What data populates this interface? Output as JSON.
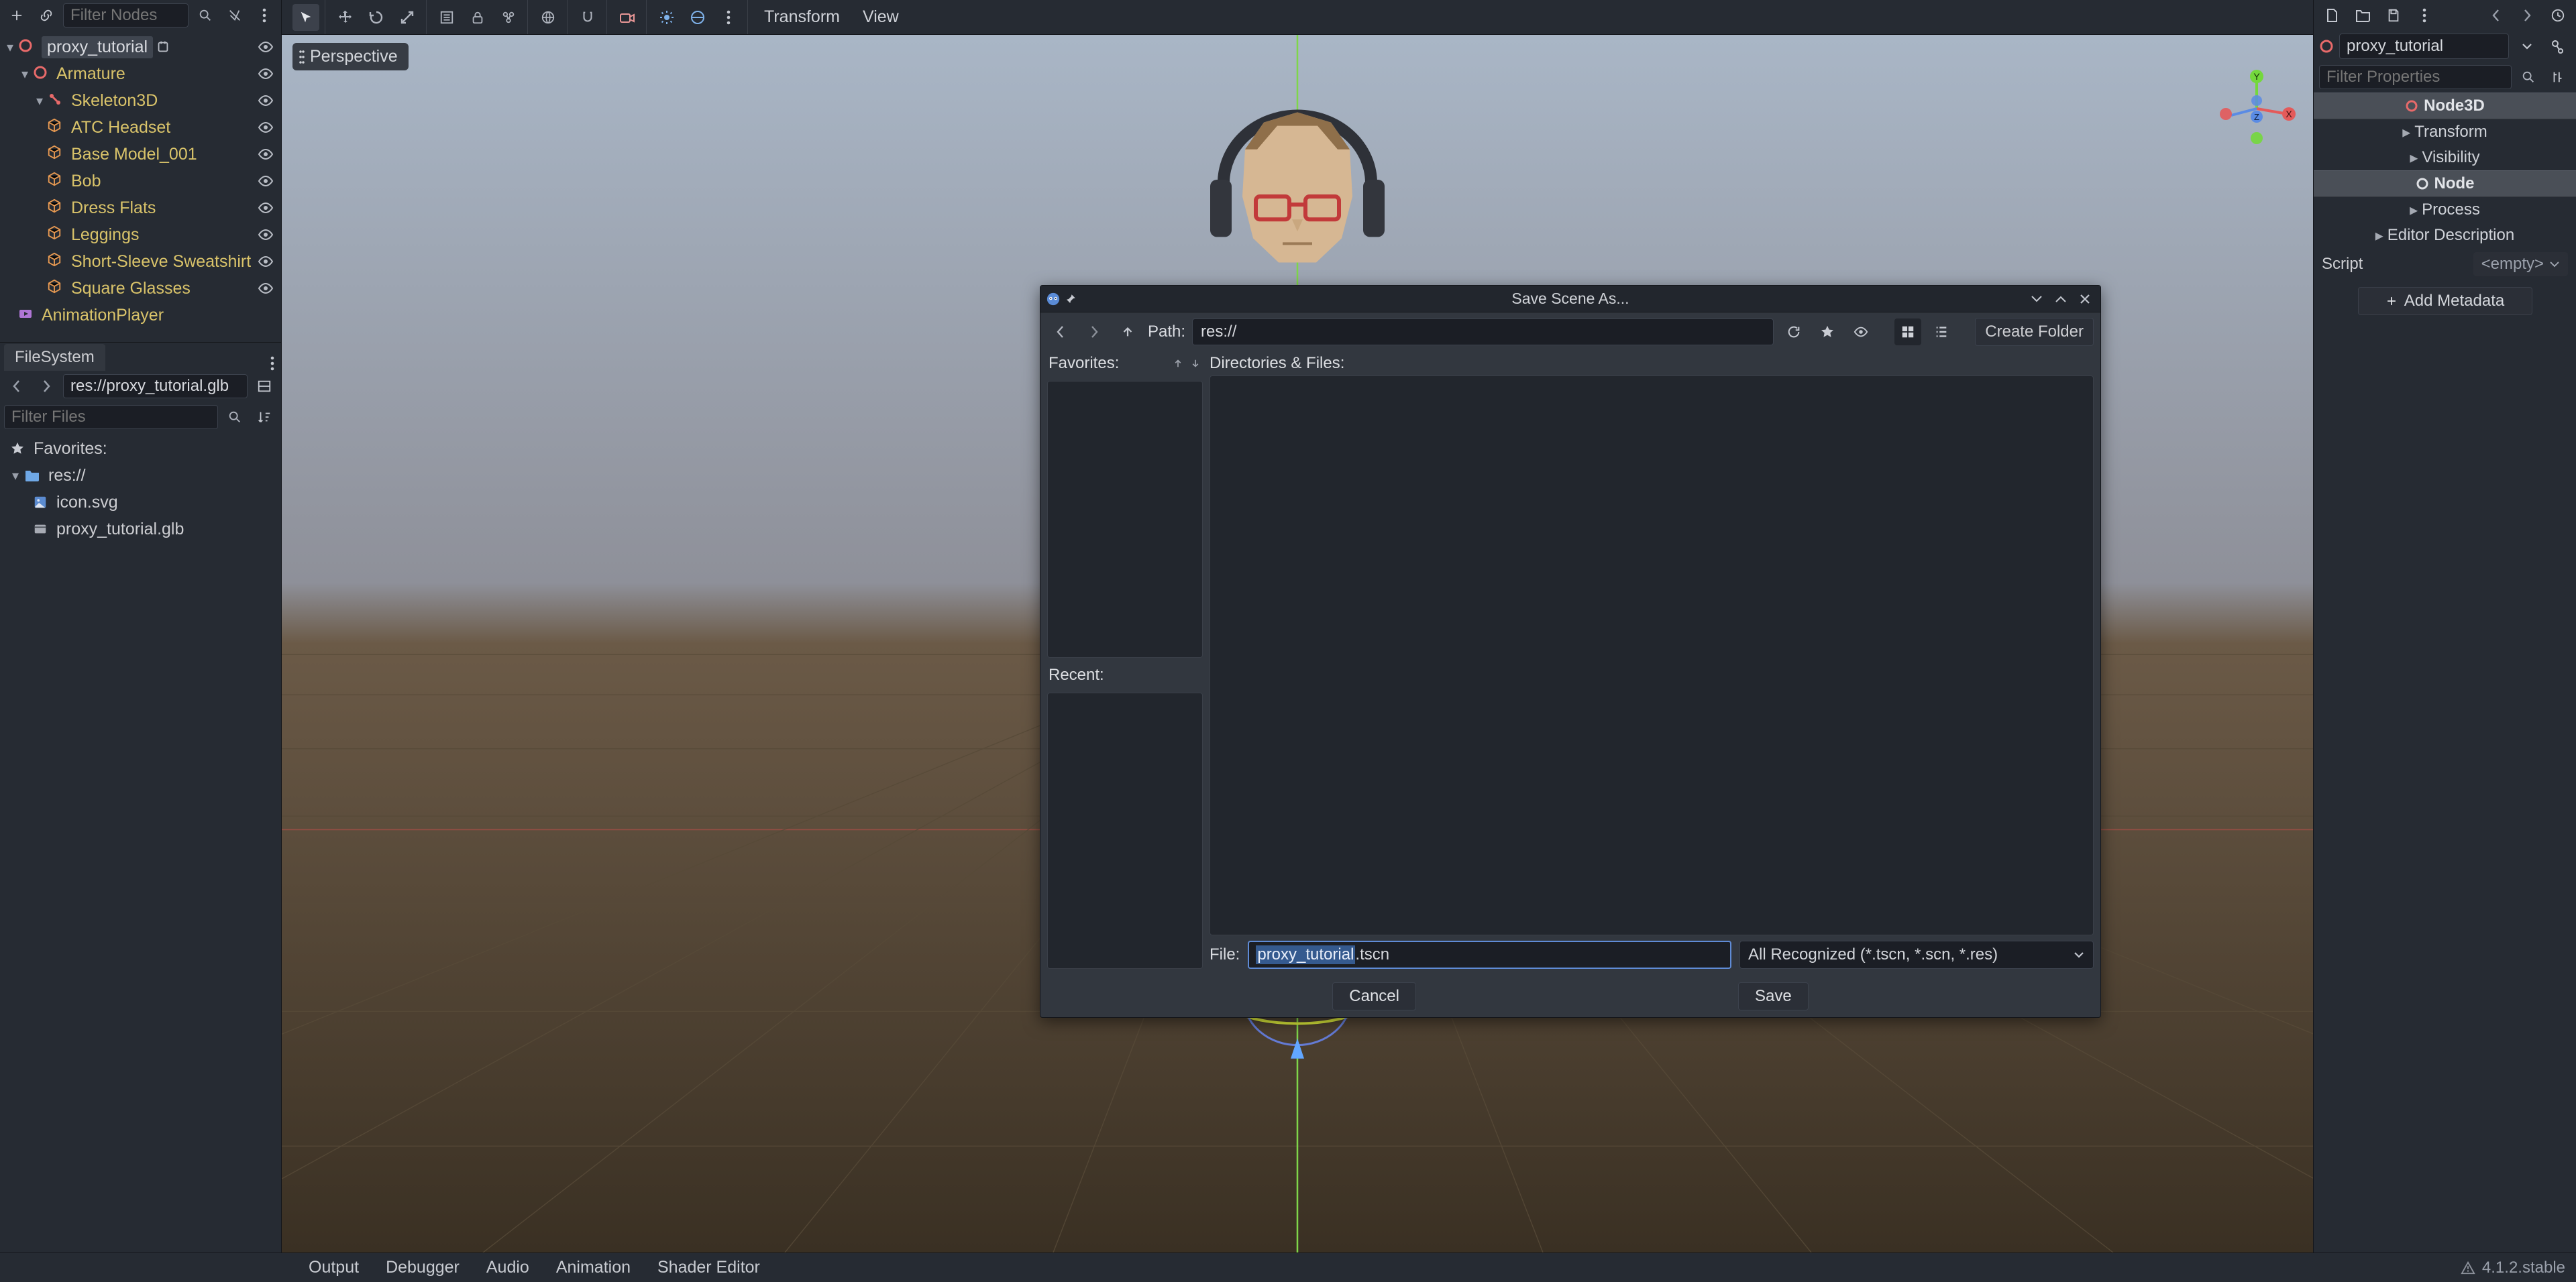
{
  "scene_panel": {
    "filter_placeholder": "Filter Nodes",
    "root": "proxy_tutorial",
    "nodes": {
      "armature": "Armature",
      "skeleton": "Skeleton3D",
      "meshes": [
        "ATC Headset",
        "Base Model_001",
        "Bob",
        "Dress Flats",
        "Leggings",
        "Short-Sleeve Sweatshirt",
        "Square Glasses"
      ],
      "anim_player": "AnimationPlayer"
    }
  },
  "filesystem": {
    "tab": "FileSystem",
    "path": "res://proxy_tutorial.glb",
    "filter_placeholder": "Filter Files",
    "favorites_label": "Favorites:",
    "root": "res://",
    "files": [
      "icon.svg",
      "proxy_tutorial.glb"
    ]
  },
  "viewport": {
    "perspective": "Perspective",
    "menus": {
      "transform": "Transform",
      "view": "View"
    },
    "axes": {
      "x": "X",
      "y": "Y",
      "z": "Z"
    }
  },
  "inspector": {
    "object_name": "proxy_tutorial",
    "filter_placeholder": "Filter Properties",
    "class_header": "Node3D",
    "groups": {
      "transform": "Transform",
      "visibility": "Visibility"
    },
    "node_header": "Node",
    "node_groups": {
      "process": "Process",
      "editor_desc": "Editor Description"
    },
    "script_label": "Script",
    "script_value": "<empty>",
    "add_metadata": "Add Metadata"
  },
  "dialog": {
    "title": "Save Scene As...",
    "path_label": "Path:",
    "path_value": "res://",
    "create_folder": "Create Folder",
    "favorites_label": "Favorites:",
    "recent_label": "Recent:",
    "dir_files_label": "Directories & Files:",
    "file_label": "File:",
    "file_value_selected": "proxy_tutorial",
    "file_value_rest": ".tscn",
    "type_filter": "All Recognized (*.tscn, *.scn, *.res)",
    "cancel": "Cancel",
    "save": "Save"
  },
  "footer": {
    "tabs": [
      "Output",
      "Debugger",
      "Audio",
      "Animation",
      "Shader Editor"
    ],
    "version": "4.1.2.stable"
  }
}
